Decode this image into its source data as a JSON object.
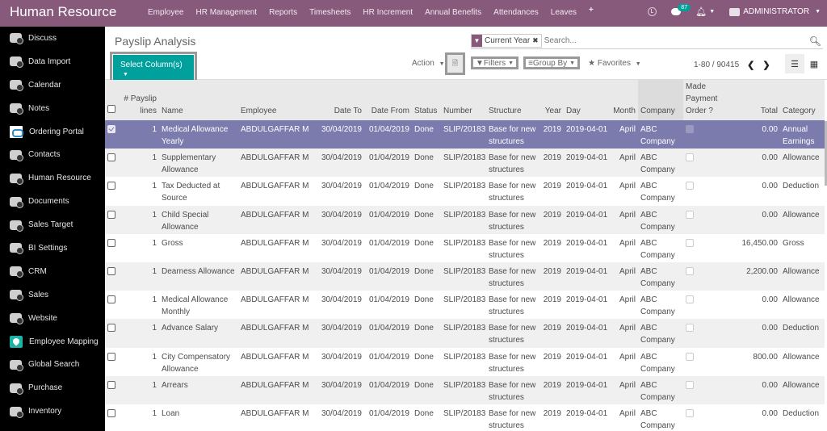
{
  "topbar": {
    "app_title": "Human Resource",
    "menu": [
      "Employee",
      "HR Management",
      "Reports",
      "Timesheets",
      "HR Increment",
      "Annual Benefits",
      "Attendances",
      "Leaves"
    ],
    "plus_icon": "+",
    "messages_count": "87",
    "user": "ADMINISTRATOR"
  },
  "sidebar": {
    "items": [
      {
        "label": "Discuss",
        "icon": "camera-icon"
      },
      {
        "label": "Data Import",
        "icon": "camera-icon"
      },
      {
        "label": "Calendar",
        "icon": "camera-icon"
      },
      {
        "label": "Notes",
        "icon": "camera-icon"
      },
      {
        "label": "Ordering Portal",
        "icon": "handshake-icon"
      },
      {
        "label": "Contacts",
        "icon": "camera-icon"
      },
      {
        "label": "Human Resource",
        "icon": "camera-icon"
      },
      {
        "label": "Documents",
        "icon": "camera-icon"
      },
      {
        "label": "Sales Target",
        "icon": "camera-icon"
      },
      {
        "label": "BI Settings",
        "icon": "camera-icon"
      },
      {
        "label": "CRM",
        "icon": "camera-icon"
      },
      {
        "label": "Sales",
        "icon": "camera-icon"
      },
      {
        "label": "Website",
        "icon": "camera-icon"
      },
      {
        "label": "Employee Mapping",
        "icon": "map-pin-icon"
      },
      {
        "label": "Global Search",
        "icon": "camera-icon"
      },
      {
        "label": "Purchase",
        "icon": "camera-icon"
      },
      {
        "label": "Inventory",
        "icon": "camera-icon"
      }
    ]
  },
  "control": {
    "title": "Payslip Analysis",
    "select_columns": "Select Column(s)",
    "action": "Action",
    "facet": "Current Year",
    "search_placeholder": "Search...",
    "filters": "Filters",
    "group_by": "Group By",
    "favorites": "Favorites",
    "pager": "1-80 / 90415"
  },
  "table": {
    "headers": [
      "# Payslip lines",
      "Name",
      "Employee",
      "Date To",
      "Date From",
      "Status",
      "Number",
      "Structure",
      "Year",
      "Day",
      "Month",
      "Company",
      "Made Payment Order ?",
      "Total",
      "Category"
    ],
    "rows": [
      {
        "lines": "1",
        "name": "Medical Allowance Yearly",
        "employee": "ABDULGAFFAR M",
        "date_to": "30/04/2019",
        "date_from": "01/04/2019",
        "status": "Done",
        "number": "SLIP/20183",
        "structure": "Base for new structures",
        "year": "2019",
        "day": "2019-04-01",
        "month": "April",
        "company": "ABC Company",
        "paid": false,
        "total": "0.00",
        "category": "Annual Earnings",
        "selected": true
      },
      {
        "lines": "1",
        "name": "Supplementary Allowance",
        "employee": "ABDULGAFFAR M",
        "date_to": "30/04/2019",
        "date_from": "01/04/2019",
        "status": "Done",
        "number": "SLIP/20183",
        "structure": "Base for new structures",
        "year": "2019",
        "day": "2019-04-01",
        "month": "April",
        "company": "ABC Company",
        "paid": false,
        "total": "0.00",
        "category": "Allowance",
        "selected": false
      },
      {
        "lines": "1",
        "name": "Tax Deducted at Source",
        "employee": "ABDULGAFFAR M",
        "date_to": "30/04/2019",
        "date_from": "01/04/2019",
        "status": "Done",
        "number": "SLIP/20183",
        "structure": "Base for new structures",
        "year": "2019",
        "day": "2019-04-01",
        "month": "April",
        "company": "ABC Company",
        "paid": false,
        "total": "0.00",
        "category": "Deduction",
        "selected": false
      },
      {
        "lines": "1",
        "name": "Child Special Allowance",
        "employee": "ABDULGAFFAR M",
        "date_to": "30/04/2019",
        "date_from": "01/04/2019",
        "status": "Done",
        "number": "SLIP/20183",
        "structure": "Base for new structures",
        "year": "2019",
        "day": "2019-04-01",
        "month": "April",
        "company": "ABC Company",
        "paid": false,
        "total": "0.00",
        "category": "Allowance",
        "selected": false
      },
      {
        "lines": "1",
        "name": "Gross",
        "employee": "ABDULGAFFAR M",
        "date_to": "30/04/2019",
        "date_from": "01/04/2019",
        "status": "Done",
        "number": "SLIP/20183",
        "structure": "Base for new structures",
        "year": "2019",
        "day": "2019-04-01",
        "month": "April",
        "company": "ABC Company",
        "paid": false,
        "total": "16,450.00",
        "category": "Gross",
        "selected": false
      },
      {
        "lines": "1",
        "name": "Dearness Allowance",
        "employee": "ABDULGAFFAR M",
        "date_to": "30/04/2019",
        "date_from": "01/04/2019",
        "status": "Done",
        "number": "SLIP/20183",
        "structure": "Base for new structures",
        "year": "2019",
        "day": "2019-04-01",
        "month": "April",
        "company": "ABC Company",
        "paid": false,
        "total": "2,200.00",
        "category": "Allowance",
        "selected": false
      },
      {
        "lines": "1",
        "name": "Medical Allowance Monthly",
        "employee": "ABDULGAFFAR M",
        "date_to": "30/04/2019",
        "date_from": "01/04/2019",
        "status": "Done",
        "number": "SLIP/20183",
        "structure": "Base for new structures",
        "year": "2019",
        "day": "2019-04-01",
        "month": "April",
        "company": "ABC Company",
        "paid": false,
        "total": "0.00",
        "category": "Allowance",
        "selected": false
      },
      {
        "lines": "1",
        "name": "Advance Salary",
        "employee": "ABDULGAFFAR M",
        "date_to": "30/04/2019",
        "date_from": "01/04/2019",
        "status": "Done",
        "number": "SLIP/20183",
        "structure": "Base for new structures",
        "year": "2019",
        "day": "2019-04-01",
        "month": "April",
        "company": "ABC Company",
        "paid": false,
        "total": "0.00",
        "category": "Deduction",
        "selected": false
      },
      {
        "lines": "1",
        "name": "City Compensatory Allowance",
        "employee": "ABDULGAFFAR M",
        "date_to": "30/04/2019",
        "date_from": "01/04/2019",
        "status": "Done",
        "number": "SLIP/20183",
        "structure": "Base for new structures",
        "year": "2019",
        "day": "2019-04-01",
        "month": "April",
        "company": "ABC Company",
        "paid": false,
        "total": "800.00",
        "category": "Allowance",
        "selected": false
      },
      {
        "lines": "1",
        "name": "Arrears",
        "employee": "ABDULGAFFAR M",
        "date_to": "30/04/2019",
        "date_from": "01/04/2019",
        "status": "Done",
        "number": "SLIP/20183",
        "structure": "Base for new structures",
        "year": "2019",
        "day": "2019-04-01",
        "month": "April",
        "company": "ABC Company",
        "paid": false,
        "total": "0.00",
        "category": "Allowance",
        "selected": false
      },
      {
        "lines": "1",
        "name": "Loan",
        "employee": "ABDULGAFFAR M",
        "date_to": "30/04/2019",
        "date_from": "01/04/2019",
        "status": "Done",
        "number": "SLIP/20183",
        "structure": "Base for new structures",
        "year": "2019",
        "day": "2019-04-01",
        "month": "April",
        "company": "ABC Company",
        "paid": false,
        "total": "0.00",
        "category": "Deduction",
        "selected": false
      }
    ]
  },
  "colors": {
    "brand": "#875a7b",
    "accent": "#00a09d",
    "selected_row": "#7c7bad"
  }
}
